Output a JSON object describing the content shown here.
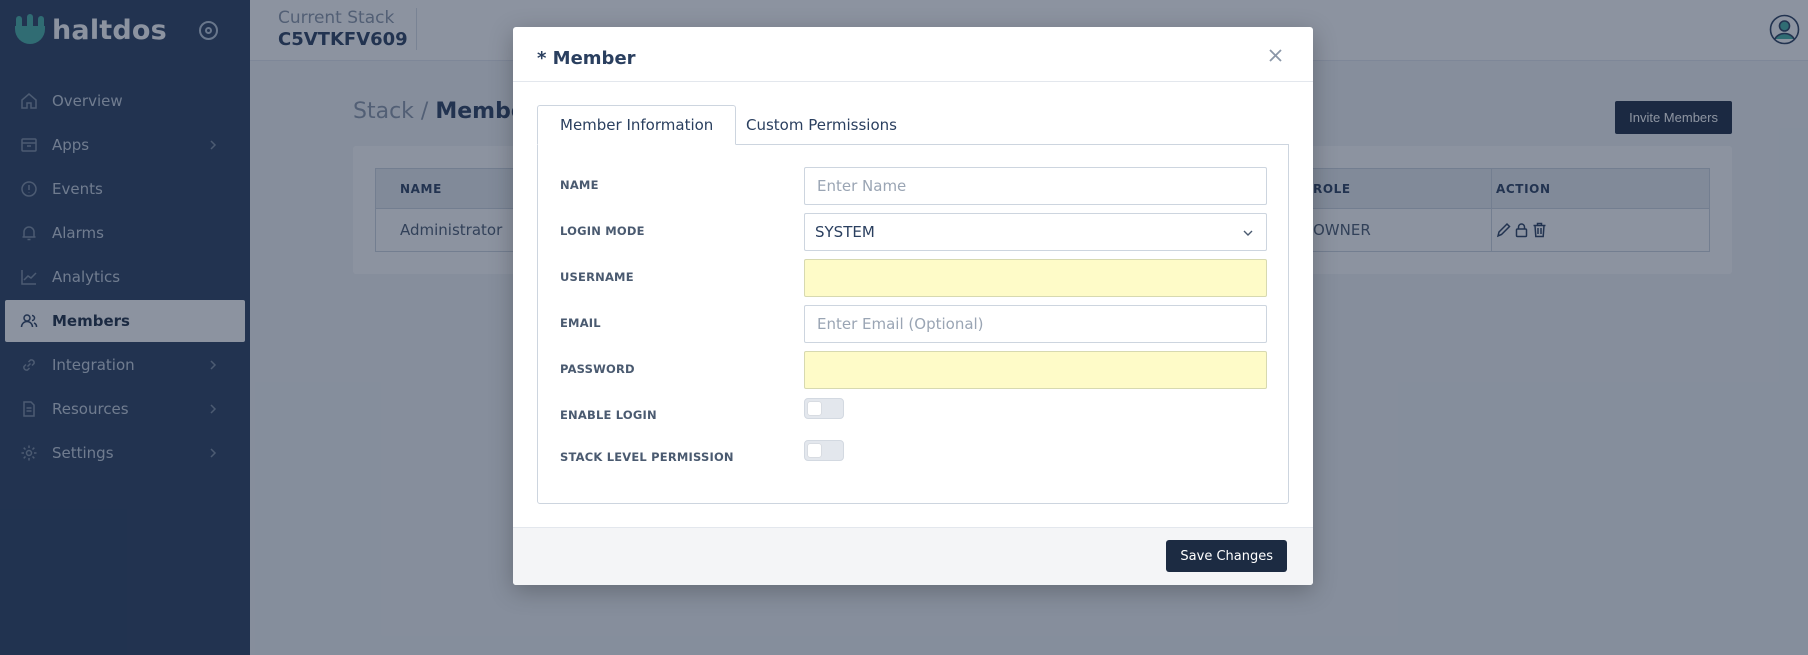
{
  "brand": {
    "name": "haltdos",
    "color": "#46b0a5"
  },
  "sidebar": {
    "items": [
      {
        "label": "Overview",
        "icon": "home-icon",
        "has_submenu": false,
        "active": false
      },
      {
        "label": "Apps",
        "icon": "box-icon",
        "has_submenu": true,
        "active": false
      },
      {
        "label": "Events",
        "icon": "alert-circle-icon",
        "has_submenu": false,
        "active": false
      },
      {
        "label": "Alarms",
        "icon": "bell-icon",
        "has_submenu": false,
        "active": false
      },
      {
        "label": "Analytics",
        "icon": "chart-line-icon",
        "has_submenu": false,
        "active": false
      },
      {
        "label": "Members",
        "icon": "users-icon",
        "has_submenu": false,
        "active": true
      },
      {
        "label": "Integration",
        "icon": "link-icon",
        "has_submenu": true,
        "active": false
      },
      {
        "label": "Resources",
        "icon": "document-icon",
        "has_submenu": true,
        "active": false
      },
      {
        "label": "Settings",
        "icon": "gear-icon",
        "has_submenu": true,
        "active": false
      }
    ]
  },
  "topbar": {
    "stack_caption": "Current Stack",
    "stack_id": "C5VTKFV609"
  },
  "page": {
    "breadcrumb_parent": "Stack",
    "breadcrumb_separator": "/",
    "breadcrumb_current": "Members",
    "invite_button": "Invite Members"
  },
  "table": {
    "headers": {
      "name": "NAME",
      "role": "ROLE",
      "action": "ACTION"
    },
    "rows": [
      {
        "name": "Administrator",
        "role": "OWNER"
      }
    ]
  },
  "modal": {
    "title": "* Member",
    "tabs": [
      "Member Information",
      "Custom Permissions"
    ],
    "fields": {
      "name": {
        "label": "NAME",
        "placeholder": "Enter Name",
        "value": ""
      },
      "login_mode": {
        "label": "LOGIN MODE",
        "value": "SYSTEM"
      },
      "username": {
        "label": "USERNAME",
        "value": ""
      },
      "email": {
        "label": "EMAIL",
        "placeholder": "Enter Email (Optional)",
        "value": ""
      },
      "password": {
        "label": "PASSWORD",
        "value": ""
      },
      "enable_login": {
        "label": "ENABLE LOGIN",
        "on": false
      },
      "stack_level_permission": {
        "label": "STACK LEVEL PERMISSION",
        "on": false
      }
    },
    "save_button": "Save Changes"
  },
  "colors": {
    "sidebar_bg": "#2a3f5f",
    "primary_button": "#1c2b42",
    "autofill": "#fefbc8",
    "overlay": "rgba(25,40,65,0.5)"
  }
}
